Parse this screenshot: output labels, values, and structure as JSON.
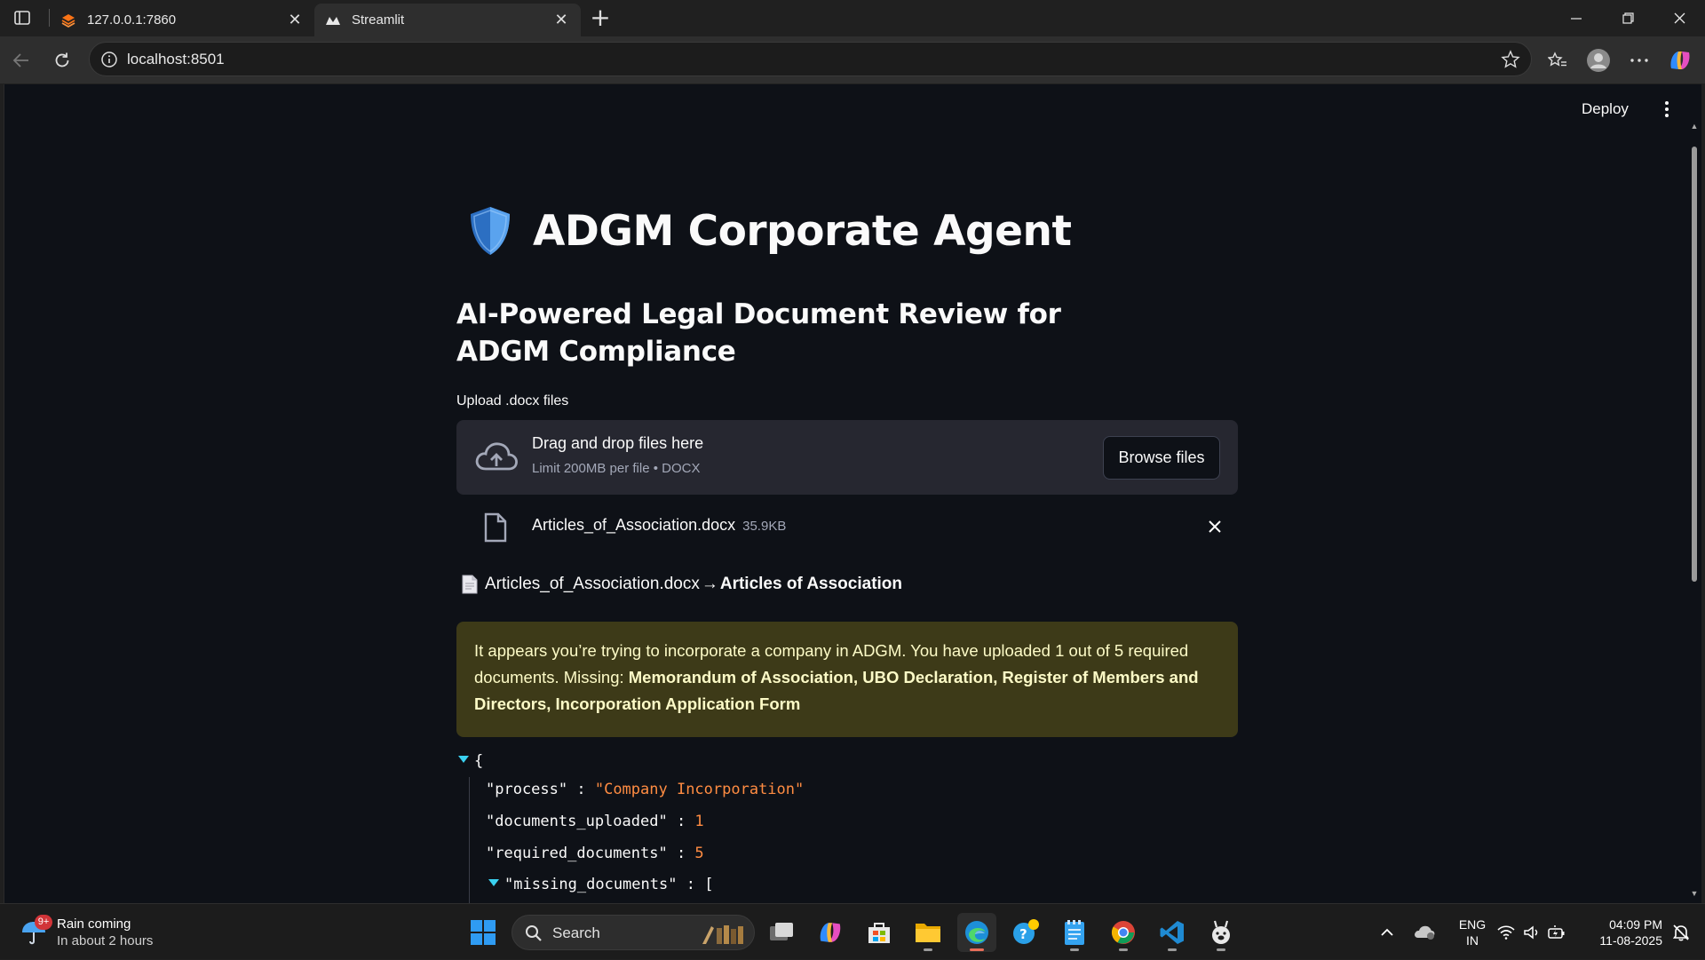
{
  "browser": {
    "tabs": [
      {
        "title": "127.0.0.1:7860"
      },
      {
        "title": "Streamlit"
      }
    ],
    "url": "localhost:8501"
  },
  "app": {
    "deploy_label": "Deploy",
    "title": "ADGM Corporate Agent",
    "subtitle": "AI-Powered Legal Document Review for ADGM Compliance",
    "uploader": {
      "label": "Upload .docx files",
      "drop_text": "Drag and drop files here",
      "limit_text": "Limit 200MB per file • DOCX",
      "browse_label": "Browse files"
    },
    "uploaded_file": {
      "name": "Articles_of_Association.docx",
      "size": "35.9KB"
    },
    "detection": {
      "file": "Articles_of_Association.docx",
      "arrow": "→",
      "type": "Articles of Association"
    },
    "warning": {
      "text": "It appears you’re trying to incorporate a company in ADGM. You have uploaded 1 out of 5 required documents. Missing: ",
      "missing_bold": "Memorandum of Association, UBO Declaration, Register of Members and Directors, Incorporation Application Form"
    },
    "json_view": {
      "open_brace": "{",
      "rows": [
        {
          "key": "\"process\"",
          "value": "\"Company Incorporation\""
        },
        {
          "key": "\"documents_uploaded\"",
          "value": "1"
        },
        {
          "key": "\"required_documents\"",
          "value": "5"
        }
      ],
      "nested_key": "\"missing_documents\"",
      "nested_open": "[",
      "colon": " : "
    }
  },
  "taskbar": {
    "weather_title": "Rain coming",
    "weather_sub": "In about 2 hours",
    "weather_badge": "9+",
    "search_label": "Search",
    "lang_top": "ENG",
    "lang_bottom": "IN",
    "time": "04:09 PM",
    "date": "11-08-2025"
  },
  "colors": {
    "app_bg": "#0e1117",
    "warning_bg": "#3d3a18",
    "warning_text": "#fdfbc7",
    "json_value": "#ff8c42",
    "json_caret": "#3ad1f0"
  }
}
